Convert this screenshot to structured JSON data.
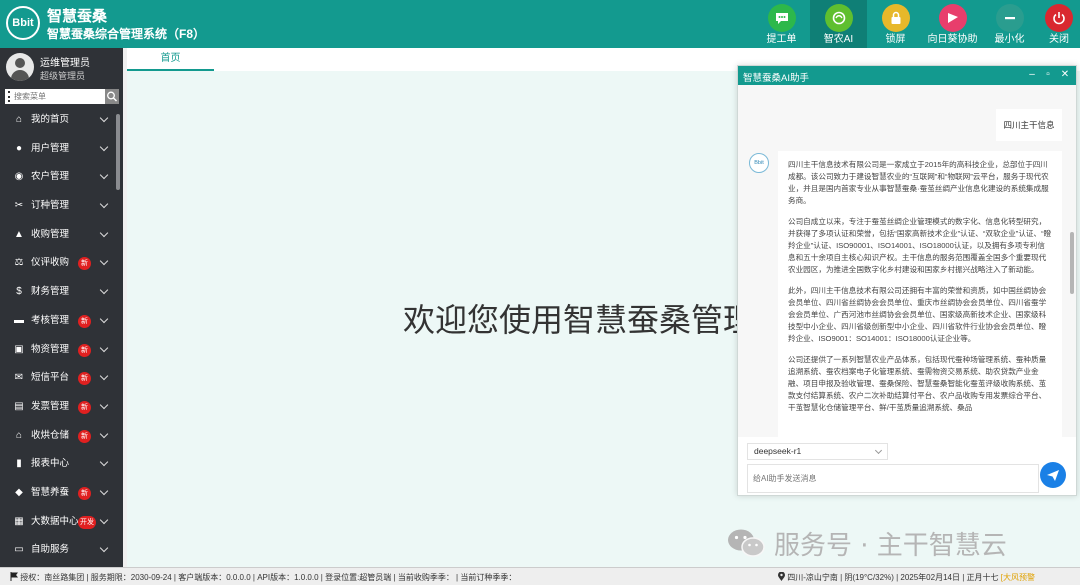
{
  "header": {
    "logo_text": "Bbit",
    "brand": "智慧蚕桑",
    "system_title": "智慧蚕桑综合管理系统（F8）",
    "buttons": [
      {
        "label": "提工单",
        "icon": "chat-icon",
        "color": "#2db84b"
      },
      {
        "label": "智农AI",
        "icon": "ai-icon",
        "color": "#5fbf2f"
      },
      {
        "label": "锁屏",
        "icon": "lock-icon",
        "color": "#e7b82a"
      },
      {
        "label": "向日葵协助",
        "icon": "remote-assist-icon",
        "color": "#e83e6c"
      },
      {
        "label": "最小化",
        "icon": "minimize-icon",
        "color": "#2a9d8f"
      },
      {
        "label": "关闭",
        "icon": "power-icon",
        "color": "#d9282f"
      }
    ]
  },
  "sidebar": {
    "user_name": "运维管理员",
    "user_role": "超级管理员",
    "search_placeholder": "搜索菜单",
    "items": [
      {
        "label": "我的首页",
        "icon": "home-icon",
        "badge": ""
      },
      {
        "label": "用户管理",
        "icon": "user-icon",
        "badge": ""
      },
      {
        "label": "农户管理",
        "icon": "farmer-icon",
        "badge": ""
      },
      {
        "label": "订种管理",
        "icon": "order-seed-icon",
        "badge": ""
      },
      {
        "label": "收购管理",
        "icon": "purchase-icon",
        "badge": ""
      },
      {
        "label": "仪评收购",
        "icon": "scale-icon",
        "badge": "新"
      },
      {
        "label": "财务管理",
        "icon": "dollar-icon",
        "badge": ""
      },
      {
        "label": "考核管理",
        "icon": "folder-icon",
        "badge": "新"
      },
      {
        "label": "物资管理",
        "icon": "inventory-icon",
        "badge": "新"
      },
      {
        "label": "短信平台",
        "icon": "sms-icon",
        "badge": "新"
      },
      {
        "label": "发票管理",
        "icon": "invoice-icon",
        "badge": "新"
      },
      {
        "label": "收烘仓储",
        "icon": "warehouse-icon",
        "badge": "新"
      },
      {
        "label": "报表中心",
        "icon": "chart-icon",
        "badge": ""
      },
      {
        "label": "智慧养蚕",
        "icon": "android-icon",
        "badge": "新"
      },
      {
        "label": "大数据中心",
        "icon": "grid-icon",
        "badge": "开发"
      },
      {
        "label": "自助服务",
        "icon": "folder-open-icon",
        "badge": ""
      }
    ]
  },
  "tabs": {
    "home": "首页"
  },
  "main": {
    "welcome": "欢迎您使用智慧蚕桑管理"
  },
  "ai_panel": {
    "title": "智慧蚕桑AI助手",
    "user_message": "四川主干信息",
    "avatar_text": "Bbit",
    "paragraphs": [
      "四川主干信息技术有限公司是一家成立于2015年的高科技企业，总部位于四川成都。该公司致力于建设智慧农业的“互联网”和“物联网”云平台，服务于现代农业，并且是国内首家专业从事智慧蚕桑·蚕茧丝绸产业信息化建设的系统集成服务商。",
      "公司自成立以来，专注于蚕茧丝绸企业管理模式的数字化、信息化转型研究，并获得了多项认证和荣誉，包括“国家高新技术企业”认证、“双软企业”认证、“瞪羚企业”认证、ISO90001、ISO14001、ISO18000认证，以及拥有多项专利信息和五十余项自主核心知识产权。主干信息的服务范围覆盖全国多个重要现代农业园区，为推进全国数字化乡村建设和国家乡村振兴战略注入了新动能。",
      "此外，四川主干信息技术有限公司还拥有丰富的荣誉和资质，如中国丝绸协会会员单位、四川省丝绸协会会员单位、重庆市丝绸协会会员单位、四川省蚕学会会员单位、广西河池市丝绸协会会员单位、国家级高新技术企业、国家级科技型中小企业、四川省级创新型中小企业、四川省软件行业协会会员单位、瞪羚企业、ISO9001：SO14001：ISO18000认证企业等。",
      "公司还提供了一系列智慧农业产品体系，包括现代蚕种场管理系统、蚕种质量追溯系统、蚕农档案电子化管理系统、蚕需物资交易系统、助农贷款产业金融、项目申报及验收管理、蚕桑保险、智慧蚕桑智能化蚕茧评级收购系统、茧款支付结算系统、农户二次补助结算付平台、农户品收购专用发票综合平台、干茧智慧化仓储管理平台、鲜/干茧质量追溯系统、桑品"
    ],
    "model": "deepseek-r1",
    "input_placeholder": "给AI助手发送消息"
  },
  "watermark": "服务号 · 主干智慧云",
  "statusbar": {
    "left": "授权：南丝路集团 | 服务期限：2030-09-24 | 客户端版本：0.0.0.0 | API版本：1.0.0.0 | 登录位置:超管员端 | 当前收购季季： | 当前订种季季：",
    "right": "四川-凉山宁南 | 阴(19°C/32%) | 2025年02月14日 | 正月十七",
    "weather": "[大风预警"
  }
}
